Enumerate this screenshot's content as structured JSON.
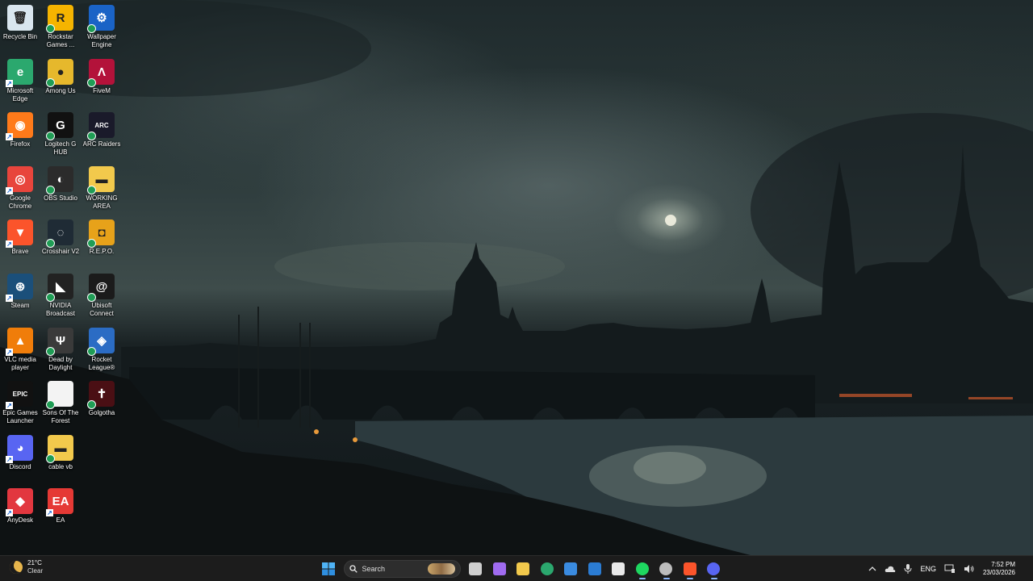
{
  "desktop": {
    "icons": [
      {
        "label": "Recycle Bin",
        "icon": "recycle-bin-icon",
        "color": "#d9e6ef",
        "glyph": "🗑",
        "status": "none"
      },
      {
        "label": "Rockstar Games ...",
        "icon": "rockstar-games-icon",
        "color": "#f5b400",
        "glyph": "R",
        "status": "synced"
      },
      {
        "label": "Wallpaper Engine",
        "icon": "wallpaper-engine-icon",
        "color": "#1a63c6",
        "glyph": "⚙",
        "status": "synced"
      },
      {
        "label": "Microsoft Edge",
        "icon": "edge-icon",
        "color": "#2ba86e",
        "glyph": "e",
        "status": "shortcut"
      },
      {
        "label": "Among Us",
        "icon": "among-us-icon",
        "color": "#e6b82c",
        "glyph": "●",
        "status": "synced"
      },
      {
        "label": "FiveM",
        "icon": "fivem-icon",
        "color": "#b3123a",
        "glyph": "Λ",
        "status": "synced"
      },
      {
        "label": "Firefox",
        "icon": "firefox-icon",
        "color": "#ff7a1a",
        "glyph": "◉",
        "status": "shortcut"
      },
      {
        "label": "Logitech G HUB",
        "icon": "logitech-ghub-icon",
        "color": "#111111",
        "glyph": "G",
        "status": "synced"
      },
      {
        "label": "ARC Raiders",
        "icon": "arc-raiders-icon",
        "color": "#1a1a2a",
        "glyph": "ARC",
        "status": "synced"
      },
      {
        "label": "Google Chrome",
        "icon": "chrome-icon",
        "color": "#e8453c",
        "glyph": "◎",
        "status": "shortcut"
      },
      {
        "label": "OBS Studio",
        "icon": "obs-studio-icon",
        "color": "#2b2b2b",
        "glyph": "◐",
        "status": "synced"
      },
      {
        "label": "WORKING AREA",
        "icon": "folder-icon",
        "color": "#f2c94c",
        "glyph": "▬",
        "status": "synced"
      },
      {
        "label": "Brave",
        "icon": "brave-icon",
        "color": "#fb542b",
        "glyph": "▼",
        "status": "shortcut"
      },
      {
        "label": "Crosshair V2",
        "icon": "crosshair-icon",
        "color": "#1f2b35",
        "glyph": "◌",
        "status": "synced"
      },
      {
        "label": "R.E.P.O.",
        "icon": "repo-icon",
        "color": "#e7a21a",
        "glyph": "◘",
        "status": "synced"
      },
      {
        "label": "Steam",
        "icon": "steam-icon",
        "color": "#1b4f7a",
        "glyph": "⊛",
        "status": "shortcut"
      },
      {
        "label": "NVIDIA Broadcast",
        "icon": "nvidia-broadcast-icon",
        "color": "#222222",
        "glyph": "◣",
        "status": "synced"
      },
      {
        "label": "Ubisoft Connect",
        "icon": "ubisoft-connect-icon",
        "color": "#1b1b1b",
        "glyph": "@",
        "status": "synced"
      },
      {
        "label": "VLC media player",
        "icon": "vlc-icon",
        "color": "#f07d0a",
        "glyph": "▲",
        "status": "shortcut"
      },
      {
        "label": "Dead by Daylight",
        "icon": "dead-by-daylight-icon",
        "color": "#3a3a3a",
        "glyph": "Ψ",
        "status": "synced"
      },
      {
        "label": "Rocket League®",
        "icon": "rocket-league-icon",
        "color": "#2b6cc4",
        "glyph": "◈",
        "status": "synced"
      },
      {
        "label": "Epic Games Launcher",
        "icon": "epic-games-icon",
        "color": "#111111",
        "glyph": "EPIC",
        "status": "shortcut"
      },
      {
        "label": "Sons Of The Forest",
        "icon": "file-icon",
        "color": "#f3f3f3",
        "glyph": "",
        "status": "synced"
      },
      {
        "label": "Golgotha",
        "icon": "golgotha-icon",
        "color": "#4a0f14",
        "glyph": "✝",
        "status": "synced"
      },
      {
        "label": "Discord",
        "icon": "discord-icon",
        "color": "#5865f2",
        "glyph": "◕",
        "status": "shortcut"
      },
      {
        "label": "cable vb",
        "icon": "folder-icon",
        "color": "#f2c94c",
        "glyph": "▬",
        "status": "synced"
      },
      {
        "label": "",
        "icon": "",
        "color": "",
        "glyph": "",
        "status": "none"
      },
      {
        "label": "AnyDesk",
        "icon": "anydesk-icon",
        "color": "#e2373f",
        "glyph": "◆",
        "status": "shortcut"
      },
      {
        "label": "EA",
        "icon": "ea-icon",
        "color": "#e53935",
        "glyph": "EA",
        "status": "shortcut"
      }
    ]
  },
  "taskbar": {
    "weather": {
      "temp": "21°C",
      "condition": "Clear",
      "icon": "moon-weather-icon"
    },
    "search": {
      "placeholder": "Search"
    },
    "pinned": [
      {
        "name": "task-view-icon",
        "color": "#cfcfcf",
        "active": false
      },
      {
        "name": "copilot-icon",
        "color": "#a06bf0",
        "active": false
      },
      {
        "name": "file-explorer-icon",
        "color": "#f2c94c",
        "active": false
      },
      {
        "name": "edge-icon",
        "color": "#2ba86e",
        "active": false
      },
      {
        "name": "microsoft-store-icon",
        "color": "#3a8be0",
        "active": false
      },
      {
        "name": "outlook-icon",
        "color": "#2b7cd3",
        "active": false
      },
      {
        "name": "logitech-ghub-icon",
        "color": "#e9e9e9",
        "active": false
      },
      {
        "name": "spotify-icon",
        "color": "#1ed760",
        "active": true
      },
      {
        "name": "obs-studio-icon",
        "color": "#bdbdbd",
        "active": true
      },
      {
        "name": "brave-icon",
        "color": "#fb542b",
        "active": true
      },
      {
        "name": "discord-icon",
        "color": "#5865f2",
        "active": true
      }
    ],
    "tray": {
      "language": "ENG",
      "time": "7:52 PM",
      "date": "23/03/2026"
    }
  }
}
